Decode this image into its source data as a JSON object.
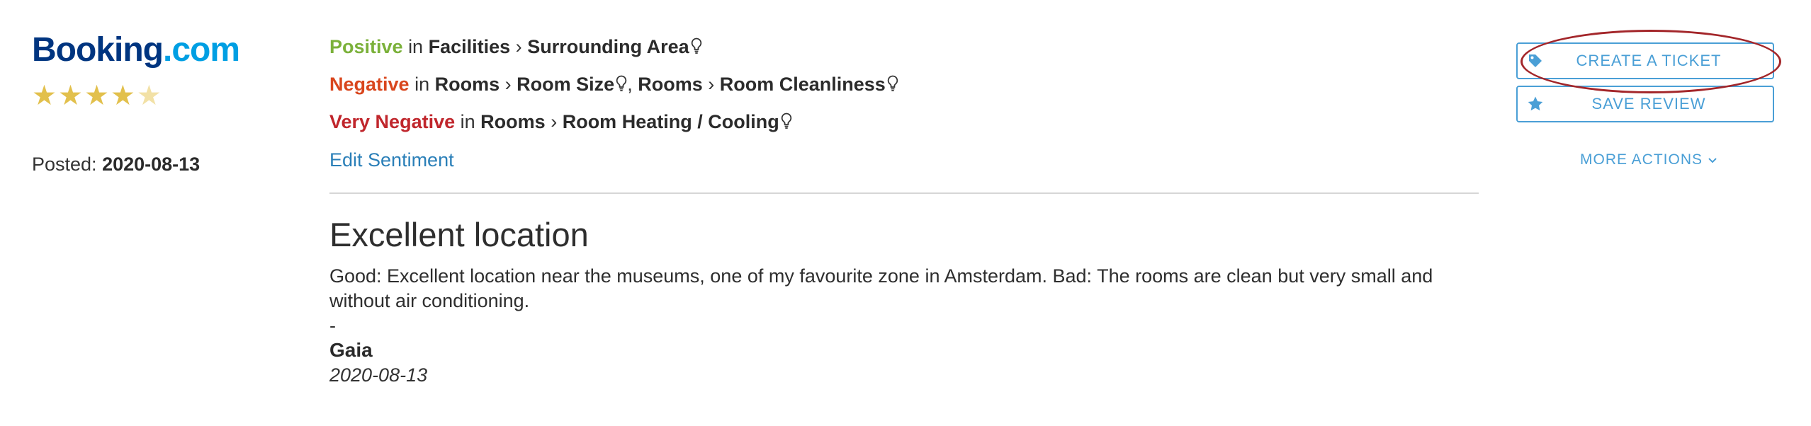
{
  "source": {
    "logo_part1": "Booking",
    "logo_part2": ".com",
    "rating_stars": 4,
    "rating_max": 5,
    "posted_label": "Posted:",
    "posted_date": "2020-08-13"
  },
  "sentiments": [
    {
      "label": "Positive",
      "in": "in",
      "category": "Facilities",
      "sep": "›",
      "topic": "Surrounding Area"
    },
    {
      "label": "Negative",
      "in": "in",
      "category": "Rooms",
      "sep": "›",
      "topic": "Room Size",
      "comma": ",",
      "category2": "Rooms",
      "sep2": "›",
      "topic2": "Room Cleanliness"
    },
    {
      "label": "Very Negative",
      "in": "in",
      "category": "Rooms",
      "sep": "›",
      "topic": "Room Heating / Cooling"
    }
  ],
  "edit_sentiment": "Edit Sentiment",
  "review": {
    "title": "Excellent location",
    "body": "Good: Excellent location near the museums, one of my favourite zone in Amsterdam. Bad: The rooms are clean but very small and without air conditioning.",
    "separator": "-",
    "author": "Gaia",
    "date": "2020-08-13"
  },
  "actions": {
    "create_ticket": "CREATE A TICKET",
    "save_review": "SAVE REVIEW",
    "more_actions": "MORE ACTIONS"
  },
  "colors": {
    "positive": "#7bb13a",
    "negative": "#d9461d",
    "very_negative": "#c0262c",
    "accent": "#4a9fd6",
    "highlight_circle": "#a3262a"
  }
}
